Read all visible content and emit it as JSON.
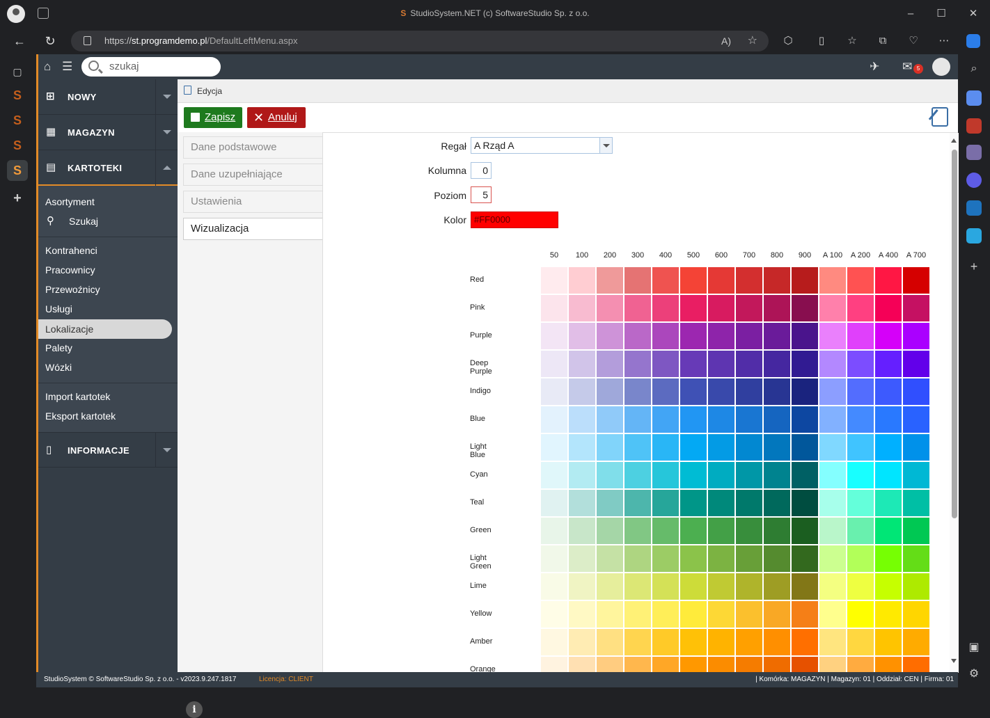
{
  "browser": {
    "title": "StudioSystem.NET (c) SoftwareStudio Sp. z o.o.",
    "url_scheme": "https://",
    "url_host": "st.programdemo.pl",
    "url_path": "/DefaultLeftMenu.aspx",
    "mail_count": "5"
  },
  "search": {
    "placeholder": "szukaj"
  },
  "sidebar": {
    "heads": [
      "NOWY",
      "MAGAZYN",
      "KARTOTEKI",
      "INFORMACJE"
    ],
    "kartoteki_items": [
      "Asortyment",
      "Szukaj",
      "Kontrahenci",
      "Pracownicy",
      "Przewoźnicy",
      "Usługi",
      "Lokalizacje",
      "Palety",
      "Wózki",
      "Import kartotek",
      "Eksport kartotek"
    ]
  },
  "content": {
    "breadcrumb": "Edycja",
    "save_label": "Zapisz",
    "cancel_label": "Anuluj",
    "tabs": [
      "Dane podstawowe",
      "Dane uzupełniające",
      "Ustawienia",
      "Wizualizacja"
    ],
    "active_tab": "Wizualizacja"
  },
  "form": {
    "regal_label": "Regał",
    "regal_value": "A Rząd A",
    "kolumna_label": "Kolumna",
    "kolumna_value": "0",
    "poziom_label": "Poziom",
    "poziom_value": "5",
    "kolor_label": "Kolor",
    "kolor_value": "#FF0000"
  },
  "palette": {
    "columns": [
      "50",
      "100",
      "200",
      "300",
      "400",
      "500",
      "600",
      "700",
      "800",
      "900",
      "A 100",
      "A 200",
      "A 400",
      "A 700"
    ],
    "rows": [
      {
        "name": "Red",
        "colors": [
          "#ffebee",
          "#ffcdd2",
          "#ef9a9a",
          "#e57373",
          "#ef5350",
          "#f44336",
          "#e53935",
          "#d32f2f",
          "#c62828",
          "#b71c1c",
          "#ff8a80",
          "#ff5252",
          "#ff1744",
          "#d50000"
        ]
      },
      {
        "name": "Pink",
        "colors": [
          "#fce4ec",
          "#f8bbd0",
          "#f48fb1",
          "#f06292",
          "#ec407a",
          "#e91e63",
          "#d81b60",
          "#c2185b",
          "#ad1457",
          "#880e4f",
          "#ff80ab",
          "#ff4081",
          "#f50057",
          "#c51162"
        ]
      },
      {
        "name": "Purple",
        "colors": [
          "#f3e5f5",
          "#e1bee7",
          "#ce93d8",
          "#ba68c8",
          "#ab47bc",
          "#9c27b0",
          "#8e24aa",
          "#7b1fa2",
          "#6a1b9a",
          "#4a148c",
          "#ea80fc",
          "#e040fb",
          "#d500f9",
          "#aa00ff"
        ]
      },
      {
        "name": "Deep Purple",
        "colors": [
          "#ede7f6",
          "#d1c4e9",
          "#b39ddb",
          "#9575cd",
          "#7e57c2",
          "#673ab7",
          "#5e35b1",
          "#512da8",
          "#4527a0",
          "#311b92",
          "#b388ff",
          "#7c4dff",
          "#651fff",
          "#6200ea"
        ]
      },
      {
        "name": "Indigo",
        "colors": [
          "#e8eaf6",
          "#c5cae9",
          "#9fa8da",
          "#7986cb",
          "#5c6bc0",
          "#3f51b5",
          "#3949ab",
          "#303f9f",
          "#283593",
          "#1a237e",
          "#8c9eff",
          "#536dfe",
          "#3d5afe",
          "#304ffe"
        ]
      },
      {
        "name": "Blue",
        "colors": [
          "#e3f2fd",
          "#bbdefb",
          "#90caf9",
          "#64b5f6",
          "#42a5f5",
          "#2196f3",
          "#1e88e5",
          "#1976d2",
          "#1565c0",
          "#0d47a1",
          "#82b1ff",
          "#448aff",
          "#2979ff",
          "#2962ff"
        ]
      },
      {
        "name": "Light Blue",
        "colors": [
          "#e1f5fe",
          "#b3e5fc",
          "#81d4fa",
          "#4fc3f7",
          "#29b6f6",
          "#03a9f4",
          "#039be5",
          "#0288d1",
          "#0277bd",
          "#01579b",
          "#80d8ff",
          "#40c4ff",
          "#00b0ff",
          "#0091ea"
        ]
      },
      {
        "name": "Cyan",
        "colors": [
          "#e0f7fa",
          "#b2ebf2",
          "#80deea",
          "#4dd0e1",
          "#26c6da",
          "#00bcd4",
          "#00acc1",
          "#0097a7",
          "#00838f",
          "#006064",
          "#84ffff",
          "#18ffff",
          "#00e5ff",
          "#00b8d4"
        ]
      },
      {
        "name": "Teal",
        "colors": [
          "#e0f2f1",
          "#b2dfdb",
          "#80cbc4",
          "#4db6ac",
          "#26a69a",
          "#009688",
          "#00897b",
          "#00796b",
          "#00695c",
          "#004d40",
          "#a7ffeb",
          "#64ffda",
          "#1de9b6",
          "#00bfa5"
        ]
      },
      {
        "name": "Green",
        "colors": [
          "#e8f5e9",
          "#c8e6c9",
          "#a5d6a7",
          "#81c784",
          "#66bb6a",
          "#4caf50",
          "#43a047",
          "#388e3c",
          "#2e7d32",
          "#1b5e20",
          "#b9f6ca",
          "#69f0ae",
          "#00e676",
          "#00c853"
        ]
      },
      {
        "name": "Light Green",
        "colors": [
          "#f1f8e9",
          "#dcedc8",
          "#c5e1a5",
          "#aed581",
          "#9ccc65",
          "#8bc34a",
          "#7cb342",
          "#689f38",
          "#558b2f",
          "#33691e",
          "#ccff90",
          "#b2ff59",
          "#76ff03",
          "#64dd17"
        ]
      },
      {
        "name": "Lime",
        "colors": [
          "#f9fbe7",
          "#f0f4c3",
          "#e6ee9c",
          "#dce775",
          "#d4e157",
          "#cddc39",
          "#c0ca33",
          "#afb42b",
          "#9e9d24",
          "#827717",
          "#f4ff81",
          "#eeff41",
          "#c6ff00",
          "#aeea00"
        ]
      },
      {
        "name": "Yellow",
        "colors": [
          "#fffde7",
          "#fff9c4",
          "#fff59d",
          "#fff176",
          "#ffee58",
          "#ffeb3b",
          "#fdd835",
          "#fbc02d",
          "#f9a825",
          "#f57f17",
          "#ffff8d",
          "#ffff00",
          "#ffea00",
          "#ffd600"
        ]
      },
      {
        "name": "Amber",
        "colors": [
          "#fff8e1",
          "#ffecb3",
          "#ffe082",
          "#ffd54f",
          "#ffca28",
          "#ffc107",
          "#ffb300",
          "#ffa000",
          "#ff8f00",
          "#ff6f00",
          "#ffe57f",
          "#ffd740",
          "#ffc400",
          "#ffab00"
        ]
      },
      {
        "name": "Orange",
        "colors": [
          "#fff3e0",
          "#ffe0b2",
          "#ffcc80",
          "#ffb74d",
          "#ffa726",
          "#ff9800",
          "#fb8c00",
          "#f57c00",
          "#ef6c00",
          "#e65100",
          "#ffd180",
          "#ffab40",
          "#ff9100",
          "#ff6d00"
        ]
      }
    ]
  },
  "status": {
    "left": "StudioSystem © SoftwareStudio Sp. z o.o. - v2023.9.247.1817",
    "license_label": "Licencja: ",
    "license_value": "CLIENT",
    "right": "| Komórka: MAGAZYN | Magazyn: 01 | Oddział: CEN | Firma: 01"
  },
  "colors": {
    "accent": "#e38b27",
    "save_green": "#1e7a1e",
    "cancel_red": "#b01818",
    "sidebar_bg": "#3d4650"
  }
}
